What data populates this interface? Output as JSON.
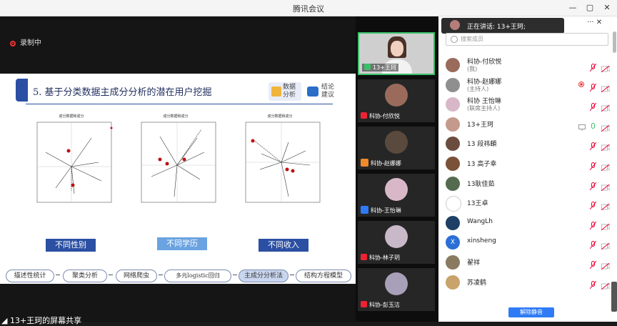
{
  "window": {
    "title": "腾讯会议"
  },
  "recording": {
    "label": "录制中"
  },
  "slide": {
    "heading": "5. 基于分类数据主成分分析的潜在用户挖掘",
    "tag1": [
      "数据",
      "分析"
    ],
    "tag2": [
      "结论",
      "建议"
    ],
    "chart_title": "成分数据和成分",
    "plot_labels": [
      "不同性别",
      "不同学历",
      "不同收入"
    ],
    "flow": [
      "描述性统计",
      "聚类分析",
      "网络爬虫",
      "多元logistic回归",
      "主成分分析法",
      "结构方程模型"
    ]
  },
  "share_label": "13+王珂的屏幕共享",
  "videos": [
    {
      "name": "13+王珂"
    },
    {
      "name": "科协-付欣悦"
    },
    {
      "name": "科协-赵娜娜"
    },
    {
      "name": "科协-王怡琳"
    },
    {
      "name": "科协-林子玥"
    },
    {
      "name": "科协-彭玉洁"
    }
  ],
  "speaking": {
    "text": "正在讲话: 13+王珂;"
  },
  "search": {
    "placeholder": "搜索成员"
  },
  "members": [
    {
      "name": "科协-付欣悦",
      "sub": "(我)",
      "color": "#9a6b5b"
    },
    {
      "name": "科协-赵娜娜",
      "sub": "(主持人)",
      "color": "#8f8f8f"
    },
    {
      "name": "科协 王怡琳",
      "sub": "(联席主持人)",
      "color": "#d8b8c8"
    },
    {
      "name": "13+王珂",
      "sub": "",
      "color": "#c49a8c"
    },
    {
      "name": "13 段祎頔",
      "sub": "",
      "color": "#6b4d3f"
    },
    {
      "name": "13 高子幸",
      "sub": "",
      "color": "#7a5238"
    },
    {
      "name": "13耿佳茹",
      "sub": "",
      "color": "#556b4f"
    },
    {
      "name": "13王卓",
      "sub": "",
      "color": "#ffffff"
    },
    {
      "name": "WangLh",
      "sub": "",
      "color": "#1e3f66"
    },
    {
      "name": "xinsheng",
      "sub": "",
      "color": "#2b6ed6"
    },
    {
      "name": "翟祥",
      "sub": "",
      "color": "#8a7a60"
    },
    {
      "name": "苏凌鹤",
      "sub": "",
      "color": "#c9a36b"
    }
  ],
  "unmute_all": "解除静音"
}
